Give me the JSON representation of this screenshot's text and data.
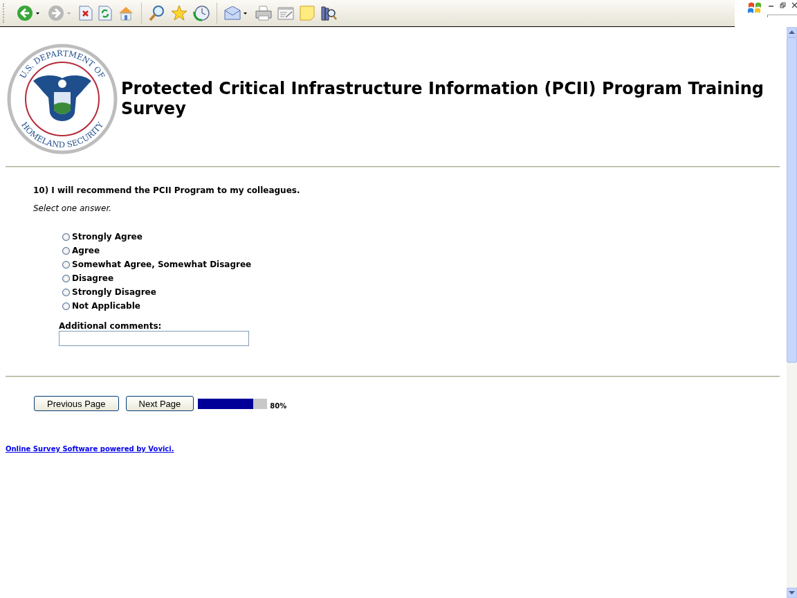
{
  "toolbar": {
    "back_disabled": false,
    "forward_disabled": true
  },
  "logo": {
    "top_text": "U.S. DEPARTMENT OF",
    "bottom_text": "HOMELAND SECURITY"
  },
  "title": "Protected Critical Infrastructure Information (PCII) Program Training Survey",
  "question": {
    "text": "10) I will recommend the PCII Program to my colleagues.",
    "instruction": "Select one answer.",
    "options": [
      {
        "label": "Strongly Agree",
        "selected": false
      },
      {
        "label": "Agree",
        "selected": false
      },
      {
        "label": "Somewhat Agree, Somewhat Disagree",
        "selected": false
      },
      {
        "label": "Disagree",
        "selected": false
      },
      {
        "label": "Strongly Disagree",
        "selected": false
      },
      {
        "label": "Not Applicable",
        "selected": false
      }
    ],
    "comments_label": "Additional comments:"
  },
  "buttons": [
    "Previous Page",
    "Next Page"
  ],
  "progress": {
    "level": 0.8,
    "reading": "80%"
  },
  "footer_link": "Online Survey Software powered by Vovici."
}
